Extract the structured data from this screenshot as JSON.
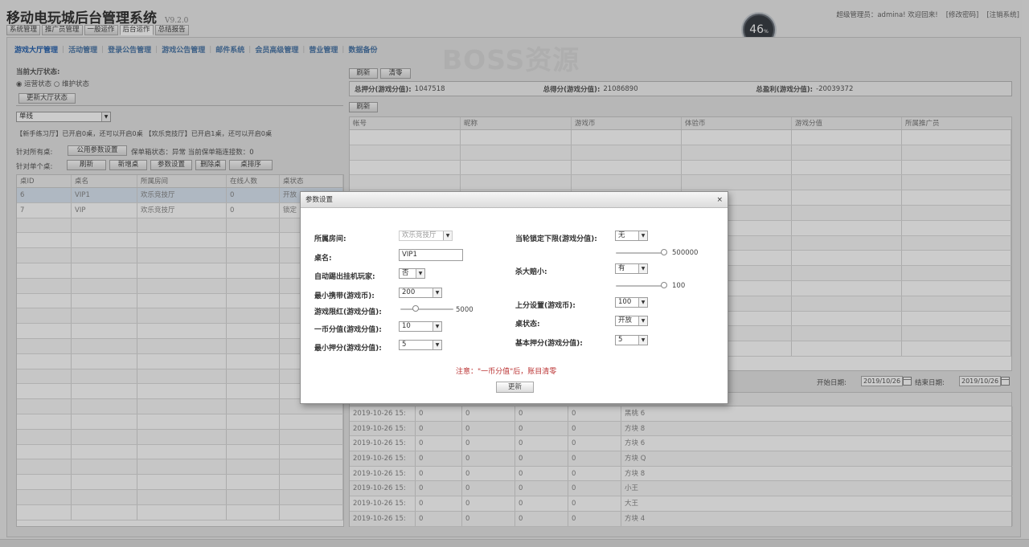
{
  "header": {
    "title": "移动电玩城后台管理系统",
    "version": "V9.2.0",
    "user_greeting": "超级管理员：admina! 欢迎回来!",
    "change_pwd": "[修改密码]",
    "logout": "[注销系统]",
    "progress_percent": "46",
    "progress_unit": "%"
  },
  "main_tabs": [
    "系统管理",
    "推广员管理",
    "一般运作",
    "后台运作",
    "总结报告"
  ],
  "sub_nav": [
    "游戏大厅管理",
    "活动管理",
    "登录公告管理",
    "游戏公告管理",
    "邮件系统",
    "会员高级管理",
    "营业管理",
    "数据备份"
  ],
  "watermark": "BOSS资源",
  "left": {
    "hall_status_label": "当前大厅状态:",
    "radio_running": "运营状态",
    "radio_maint": "维护状态",
    "update_hall_btn": "更新大厅状态",
    "mode_select": "单线",
    "info_line": "【新手练习厅】已开启0桌，还可以开启0桌  【欢乐竞技厅】已开启1桌，还可以开启0桌",
    "all_tables_label": "针对所有桌:",
    "public_params_btn": "公用参数设置",
    "safebox_status": "保单箱状态：异常 当前保单箱连接数：0",
    "single_table_label": "针对单个桌:",
    "btns": [
      "刷新",
      "新增桌",
      "参数设置",
      "删除桌",
      "桌排序"
    ],
    "table_headers": [
      "桌ID",
      "桌名",
      "所属房间",
      "在线人数",
      "桌状态"
    ],
    "table_rows": [
      [
        "6",
        "VIP1",
        "欢乐竞技厅",
        "0",
        "开放"
      ],
      [
        "7",
        "VIP",
        "欢乐竞技厅",
        "0",
        "锁定"
      ]
    ]
  },
  "right": {
    "refresh_btn": "刷新",
    "clear_btn": "清零",
    "total_bet_label": "总押分(游戏分值):",
    "total_bet": "1047518",
    "total_win_label": "总得分(游戏分值):",
    "total_win": "21086890",
    "total_profit_label": "总盈利(游戏分值):",
    "total_profit": "-20039372",
    "refresh_btn2": "刷新",
    "player_headers": [
      "帐号",
      "昵称",
      "游戏币",
      "体验币",
      "游戏分值",
      "所属推广员"
    ],
    "start_date_label": "开始日期:",
    "start_date": "2019/10/26",
    "end_date_label": "结束日期:",
    "end_date": "2019/10/26",
    "history_rows": [
      [
        "2019-10-26 15:",
        "0",
        "0",
        "0",
        "0",
        "黑桃 6"
      ],
      [
        "2019-10-26 15:",
        "0",
        "0",
        "0",
        "0",
        "方块 8"
      ],
      [
        "2019-10-26 15:",
        "0",
        "0",
        "0",
        "0",
        "方块 6"
      ],
      [
        "2019-10-26 15:",
        "0",
        "0",
        "0",
        "0",
        "方块 Q"
      ],
      [
        "2019-10-26 15:",
        "0",
        "0",
        "0",
        "0",
        "方块 8"
      ],
      [
        "2019-10-26 15:",
        "0",
        "0",
        "0",
        "0",
        "小王"
      ],
      [
        "2019-10-26 15:",
        "0",
        "0",
        "0",
        "0",
        "大王"
      ],
      [
        "2019-10-26 15:",
        "0",
        "0",
        "0",
        "0",
        "方块 4"
      ]
    ]
  },
  "dialog": {
    "title": "参数设置",
    "close": "×",
    "room_label": "所属房间:",
    "room_value": "欢乐竞技厅",
    "name_label": "桌名:",
    "name_value": "VIP1",
    "kick_label": "自动踢出挂机玩家:",
    "kick_value": "否",
    "min_carry_label": "最小携带(游戏币):",
    "min_carry_value": "200",
    "limit_label": "游戏限红(游戏分值):",
    "limit_value": "5000",
    "limit_fraction": 0.25,
    "coin_label": "一币分值(游戏分值):",
    "coin_value": "10",
    "min_bet_label": "最小押分(游戏分值):",
    "min_bet_value": "5",
    "lock_label": "当轮锁定下限(游戏分值):",
    "lock_value": "无",
    "lock_slider_value": "500000",
    "lock_fraction": 1.0,
    "kill_label": "杀大赔小:",
    "kill_value": "有",
    "kill_slider_value": "100",
    "kill_fraction": 1.0,
    "up_label": "上分设置(游戏币):",
    "up_value": "100",
    "status_label": "桌状态:",
    "status_value": "开放",
    "base_label": "基本押分(游戏分值):",
    "base_value": "5",
    "note": "注意：\"一币分值\"后，账目清零",
    "update_btn": "更新"
  }
}
